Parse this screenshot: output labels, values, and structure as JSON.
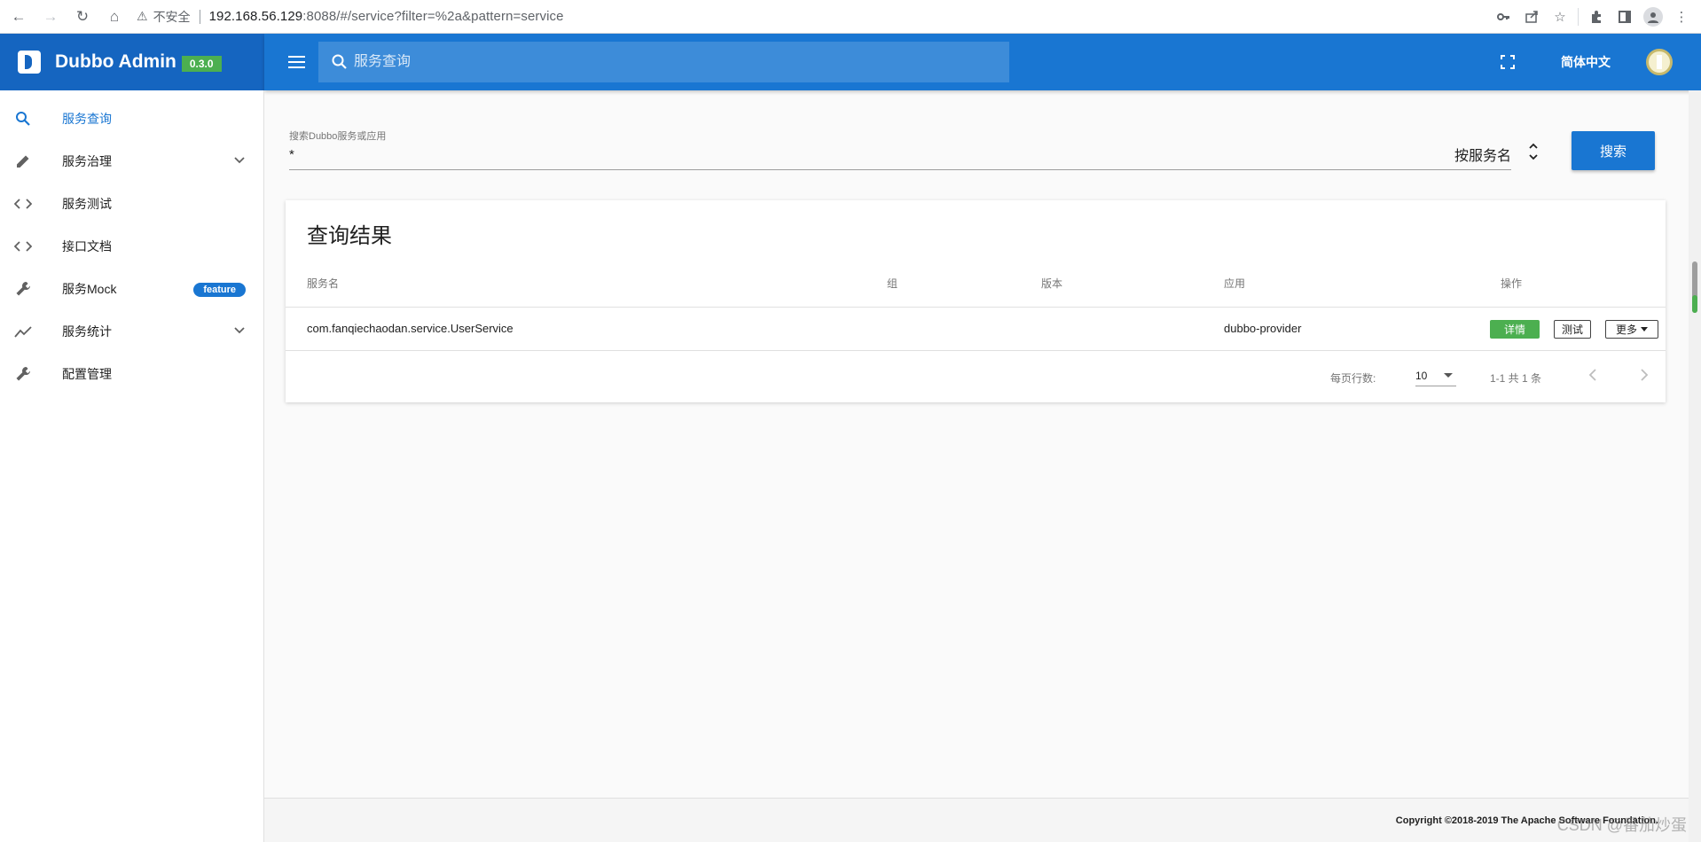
{
  "browser": {
    "insecure_label": "不安全",
    "url_host": "192.168.56.129",
    "url_rest": ":8088/#/service?filter=%2a&pattern=service"
  },
  "header": {
    "brand": "Dubbo Admin",
    "version": "0.3.0",
    "search_placeholder": "服务查询",
    "language": "简体中文"
  },
  "sidebar": {
    "items": [
      {
        "label": "服务查询"
      },
      {
        "label": "服务治理"
      },
      {
        "label": "服务测试"
      },
      {
        "label": "接口文档"
      },
      {
        "label": "服务Mock",
        "badge": "feature"
      },
      {
        "label": "服务统计"
      },
      {
        "label": "配置管理"
      }
    ]
  },
  "search": {
    "label": "搜索Dubbo服务或应用",
    "value": "*",
    "type": "按服务名",
    "button": "搜索"
  },
  "results": {
    "title": "查询结果",
    "columns": [
      "服务名",
      "组",
      "版本",
      "应用",
      "操作"
    ],
    "rows": [
      {
        "service": "com.fanqiechaodan.service.UserService",
        "group": "",
        "version": "",
        "app": "dubbo-provider"
      }
    ],
    "actions": {
      "detail": "详情",
      "test": "测试",
      "more": "更多"
    },
    "pagination": {
      "rows_per_page_label": "每页行数:",
      "rows_per_page": "10",
      "range": "1-1 共 1 条"
    }
  },
  "footer": {
    "copyright": "Copyright ©2018-2019 The Apache Software Foundation."
  },
  "watermark": "CSDN @番茄炒蛋",
  "colors": {
    "primary": "#1976d2",
    "primary_dark": "#1565c0",
    "success": "#4caf50"
  }
}
